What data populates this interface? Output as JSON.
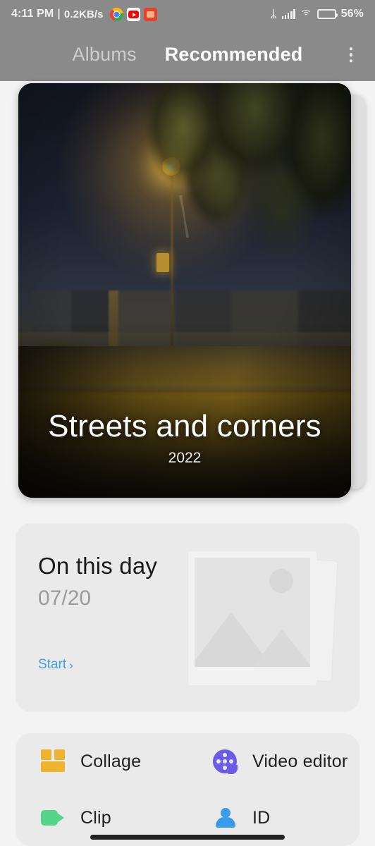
{
  "status_bar": {
    "time": "4:11 PM",
    "separator": "|",
    "network_speed": "0.2KB/s",
    "app_icons": [
      "chrome-icon",
      "youtube-icon",
      "red-app-icon"
    ],
    "bluetooth_icon": "ᛦ",
    "signal_icon": "signal-bars-icon",
    "wifi_icon": "wifi-icon",
    "battery_level": 56,
    "battery_label": "56%",
    "battery_color": "#f0b429",
    "bar_background": "#8a8a8a"
  },
  "header": {
    "tabs": [
      {
        "label": "Albums",
        "active": false
      },
      {
        "label": "Recommended",
        "active": true
      }
    ],
    "overflow_menu": "more-options"
  },
  "album": {
    "title": "Streets and corners",
    "year": "2022",
    "description": "night street scene with amber street lamp and overhanging foliage"
  },
  "on_this_day": {
    "title": "On this day",
    "date": "07/20",
    "start_label": "Start",
    "start_chevron": "›",
    "link_color": "#3ea0e8",
    "thumbnail": "photo-stack-placeholder"
  },
  "tools": [
    {
      "label": "Collage",
      "icon": "collage-icon",
      "color": "#eeb42e"
    },
    {
      "label": "Video editor",
      "icon": "film-reel-icon",
      "color": "#6b5ce7"
    },
    {
      "label": "Clip",
      "icon": "video-camera-icon",
      "color": "#56d58a"
    },
    {
      "label": "ID",
      "icon": "person-icon",
      "color": "#3a9bea"
    }
  ],
  "system": {
    "gesture_bar": "home-gesture-bar"
  }
}
